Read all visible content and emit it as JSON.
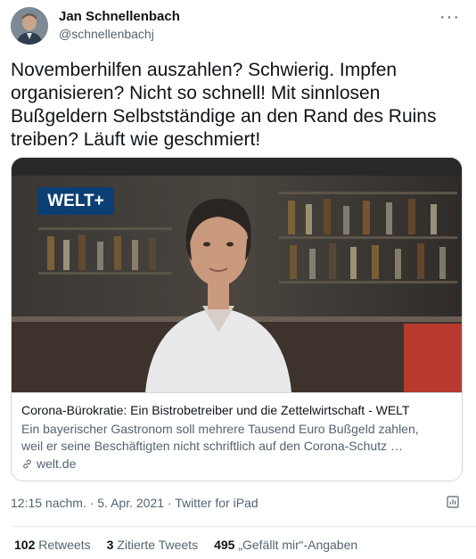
{
  "author": {
    "name": "Jan Schnellenbach",
    "handle": "@schnellenbachj"
  },
  "more_label": "···",
  "tweet_text": "Novemberhilfen auszahlen? Schwierig. Impfen\norganisieren? Nicht so schnell! Mit sinnlosen\nBußgeldern Selbstständige an den Rand des Ruins\ntreiben? Läuft wie geschmiert!",
  "card": {
    "badge": "WELT+",
    "title": "Corona-Bürokratie: Ein Bistrobetreiber und die Zettelwirtschaft - WELT",
    "description_line1": "Ein bayerischer Gastronom soll mehrere Tausend Euro Bußgeld zahlen,",
    "description_line2": "weil er seine Beschäftigten nicht schriftlich auf den Corona-Schutz …",
    "domain": "welt.de"
  },
  "meta": {
    "time": "12:15 nachm.",
    "sep1": "·",
    "date": "5. Apr. 2021",
    "sep2": "·",
    "source": "Twitter for iPad"
  },
  "stats": {
    "retweets_count": "102",
    "retweets_label": "Retweets",
    "quotes_count": "3",
    "quotes_label": "Zitierte Tweets",
    "likes_count": "495",
    "likes_label": "„Gefällt mir“-Angaben"
  },
  "colors": {
    "text": "#0f1419",
    "muted": "#536471",
    "border": "#cfd9de",
    "welt_blue": "#0b3f73"
  }
}
